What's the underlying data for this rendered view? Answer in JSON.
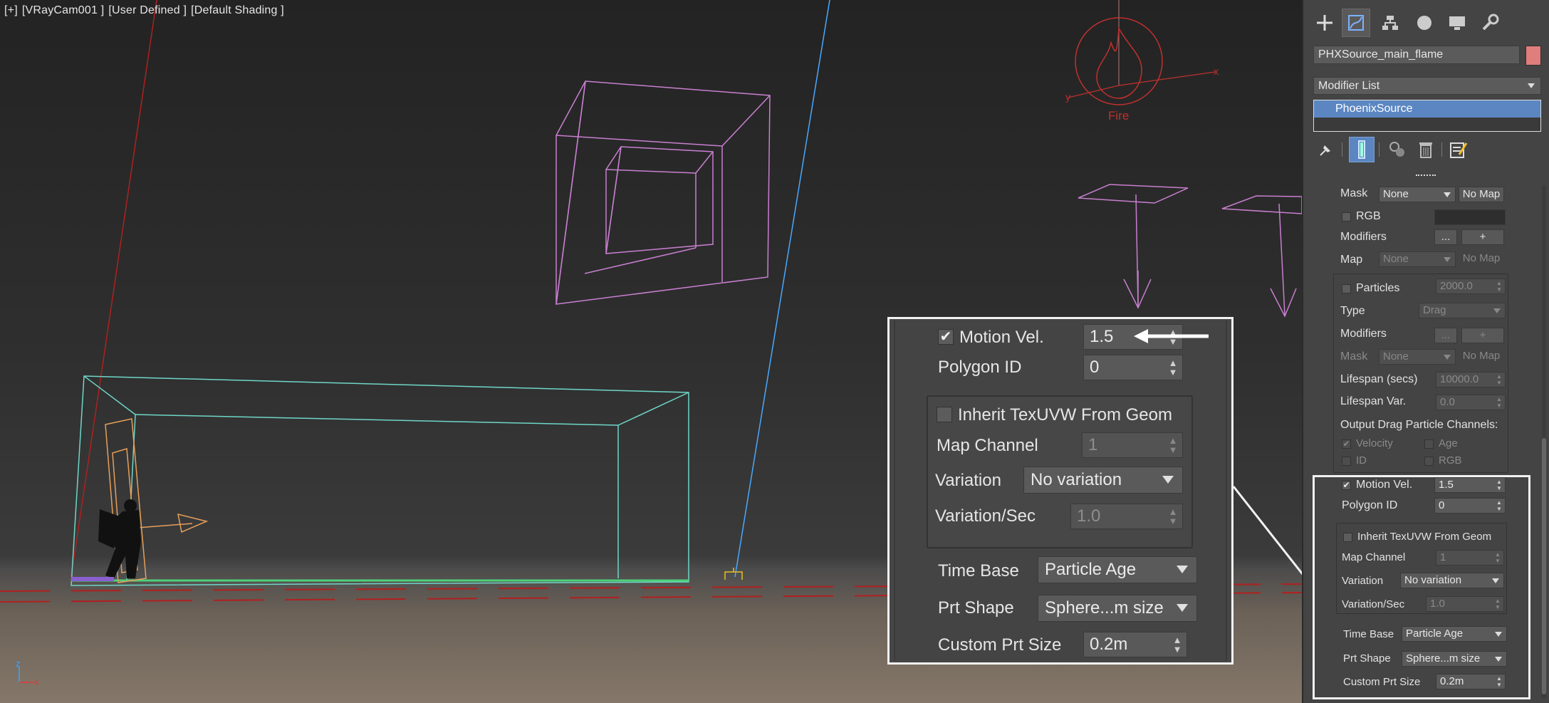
{
  "viewport": {
    "label_plus": "[+]",
    "label_camera": "[VRayCam001 ]",
    "label_mode": "[User Defined ]",
    "label_shading": "[Default Shading ]",
    "fire_label": "Fire",
    "gizmo_x": "x",
    "gizmo_y": "y",
    "axis_x": "x",
    "axis_z": "z"
  },
  "zoom": {
    "motion_vel_label": "Motion Vel.",
    "motion_vel_checked": true,
    "motion_vel_value": "1.5",
    "polygon_id_label": "Polygon ID",
    "polygon_id_value": "0",
    "inherit_label": "Inherit TexUVW From Geom",
    "map_channel_label": "Map Channel",
    "map_channel_value": "1",
    "variation_label": "Variation",
    "variation_value": "No variation",
    "variation_sec_label": "Variation/Sec",
    "variation_sec_value": "1.0",
    "time_base_label": "Time Base",
    "time_base_value": "Particle Age",
    "prt_shape_label": "Prt Shape",
    "prt_shape_value": "Sphere...m size",
    "custom_prt_label": "Custom Prt Size",
    "custom_prt_value": "0.2m"
  },
  "panel": {
    "object_name": "PHXSource_main_flame",
    "object_color": "#e07d7d",
    "modifier_list": "Modifier List",
    "stack_item": "PhoenixSource",
    "mask_label": "Mask",
    "mask_value": "None",
    "mask_nomap": "No Map",
    "rgb_label": "RGB",
    "modifiers_label": "Modifiers",
    "modifiers_dots": "...",
    "modifiers_plus": "+",
    "map_label": "Map",
    "map_value": "None",
    "map_nomap": "No Map",
    "particles_label": "Particles",
    "particles_value": "2000.0",
    "type_label": "Type",
    "type_value": "Drag",
    "modifiers2_label": "Modifiers",
    "modifiers2_dots": "...",
    "modifiers2_plus": "+",
    "mask2_label": "Mask",
    "mask2_value": "None",
    "mask2_nomap": "No Map",
    "lifespan_label": "Lifespan (secs)",
    "lifespan_value": "10000.0",
    "lifespan_var_label": "Lifespan Var.",
    "lifespan_var_value": "0.0",
    "output_label": "Output Drag Particle Channels:",
    "ch_velocity": "Velocity",
    "ch_age": "Age",
    "ch_id": "ID",
    "ch_rgb": "RGB",
    "motion_vel_label": "Motion Vel.",
    "motion_vel_value": "1.5",
    "polygon_id_label": "Polygon ID",
    "polygon_id_value": "0",
    "inherit_label": "Inherit TexUVW From Geom",
    "map_channel_label": "Map Channel",
    "map_channel_value": "1",
    "variation_label": "Variation",
    "variation_value": "No variation",
    "variation_sec_label": "Variation/Sec",
    "variation_sec_value": "1.0",
    "time_base_label": "Time Base",
    "time_base_value": "Particle Age",
    "prt_shape_label": "Prt Shape",
    "prt_shape_value": "Sphere...m size",
    "custom_prt_label": "Custom Prt Size",
    "custom_prt_value": "0.2m"
  },
  "colors": {
    "panel_bg": "#444444",
    "accent_blue": "#5b86c2",
    "wire_pink": "#c87fd0",
    "wire_cyan": "#6fd6c8",
    "fire_red": "#c0302e"
  },
  "icons": {
    "cmd_tabs": [
      "create-icon",
      "modify-icon",
      "hierarchy-icon",
      "motion-icon",
      "display-icon",
      "utilities-icon"
    ],
    "stack_tools": [
      "pin-stack-icon",
      "show-end-result-icon",
      "make-unique-icon",
      "remove-modifier-icon",
      "configure-sets-icon"
    ]
  }
}
